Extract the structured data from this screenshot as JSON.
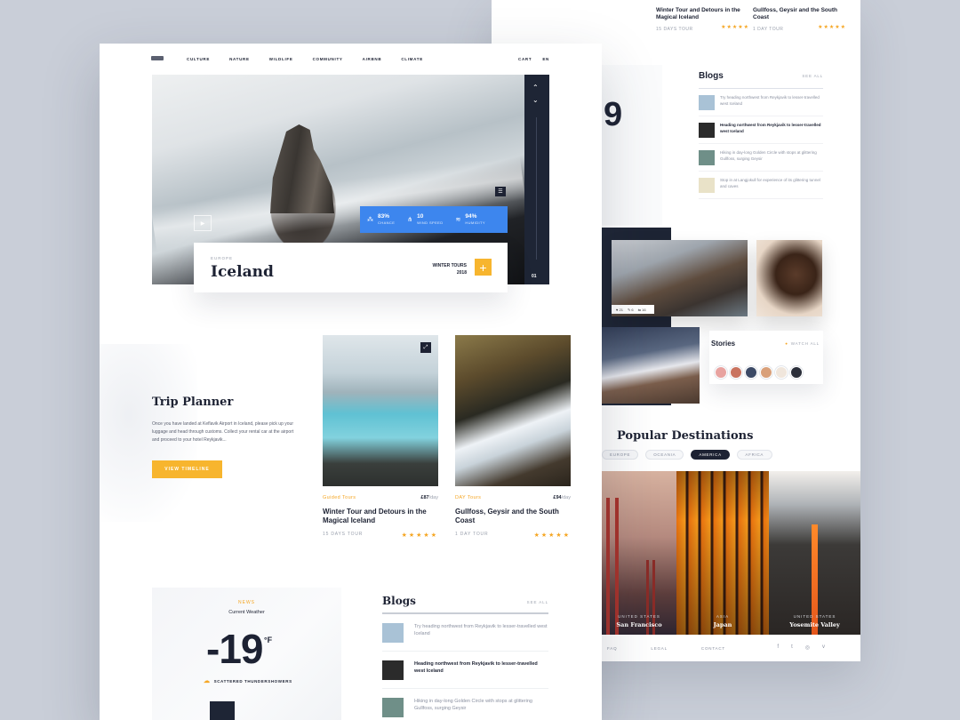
{
  "back": {
    "top_cards": [
      {
        "title": "Winter Tour and Detours in the Magical Iceland",
        "meta": "15 DAYS TOUR",
        "stars": "★★★★★"
      },
      {
        "title": "Gullfoss, Geysir and the South Coast",
        "meta": "1 DAY TOUR",
        "stars": "★★★★★"
      }
    ],
    "blogs": {
      "title": "Blogs",
      "see_all": "SEE ALL",
      "items": [
        {
          "text": "Try heading northwest from Reykjavik to lesser-travelled west Iceland",
          "highlight": false,
          "color": "#a9c2d6"
        },
        {
          "text": "Heading northwest from Reykjavik to lesser-travelled west Iceland",
          "highlight": true,
          "color": "#2b2b2b"
        },
        {
          "text": "Hiking in day-long Golden Circle with stops at glittering Gullfoss, surging Geysir",
          "highlight": false,
          "color": "#6f8f88"
        },
        {
          "text": "Stop in at Langjokull for experience of its glittering tunnel and caves",
          "highlight": false,
          "color": "#e9e2c8"
        }
      ]
    },
    "temp_partial": "9",
    "photo_bar": {
      "likes": "♥ 21",
      "comments": "✎ 6",
      "shares": "⇆ 16"
    },
    "stories": {
      "title": "Stories",
      "watch_all": "WATCH ALL",
      "avatar_colors": [
        "#e8a3a0",
        "#c9735f",
        "#3c4a66",
        "#d9a07a",
        "#f0e6dc",
        "#2b2f3a"
      ]
    },
    "popular": {
      "title": "Popular Destinations",
      "regions": [
        {
          "label": "EUROPE",
          "active": false
        },
        {
          "label": "OCEANIA",
          "active": false
        },
        {
          "label": "AMERICA",
          "active": true
        },
        {
          "label": "AFRICA",
          "active": false
        }
      ],
      "destinations": [
        {
          "country": "UNITED STATES",
          "name": "San Francisco"
        },
        {
          "country": "ASIA",
          "name": "Japan"
        },
        {
          "country": "UNITED STATES",
          "name": "Yosemite Valley"
        }
      ]
    },
    "footer": {
      "links": [
        "FAQ",
        "LEGAL",
        "CONTACT"
      ],
      "social": [
        "f",
        "t",
        "◎",
        "v"
      ]
    }
  },
  "front": {
    "nav": [
      "CULTURE",
      "NATURE",
      "WILDLIFE",
      "COMMUNITY",
      "AIRBNB",
      "CLIMATE"
    ],
    "nav_right": [
      "CART",
      "EN"
    ],
    "hero": {
      "rail_number": "01",
      "stats": [
        {
          "icon": "⁂",
          "value": "83%",
          "label": "CHANCE"
        },
        {
          "icon": "⋔",
          "value": "10",
          "label": "WIND SPEED"
        },
        {
          "icon": "≋",
          "value": "94%",
          "label": "HUMIDITY"
        }
      ],
      "region": "EUROPE",
      "name": "Iceland",
      "tours_line1": "WINTER TOURS",
      "tours_line2": "2018"
    },
    "trip_planner": {
      "title": "Trip Planner",
      "description": "Once you have landed at Keflavik Airport in Iceland, please pick up your luggage and head through customs. Collect your rental car at the airport and proceed to your hotel Reykjavik...",
      "button": "VIEW TIMELINE"
    },
    "tours": [
      {
        "category": "Guided Tours",
        "price": "£87",
        "per": "/day",
        "title": "Winter Tour and Detours in the Magical Iceland",
        "days": "15 DAYS TOUR",
        "stars": "★★★★★"
      },
      {
        "category": "DAY Tours",
        "price": "£94",
        "per": "/day",
        "title": "Gullfoss, Geysir and the South Coast",
        "days": "1 DAY TOUR",
        "stars": "★★★★★"
      }
    ],
    "weather": {
      "news": "NEWS",
      "label": "Current Weather",
      "temp": "-19",
      "unit": "°F",
      "condition": "SCATTERED THUNDERSHOWERS"
    },
    "blogs": {
      "title": "Blogs",
      "see_all": "SEE ALL",
      "items": [
        {
          "text": "Try heading northwest from Reykjavik to lesser-travelled west Iceland",
          "highlight": false,
          "color": "#a9c2d6"
        },
        {
          "text": "Heading northwest from Reykjavik to lesser-travelled west Iceland",
          "highlight": true,
          "color": "#2b2b2b"
        },
        {
          "text": "Hiking in day-long Golden Circle with stops at glittering Gullfoss, surging Geysir",
          "highlight": false,
          "color": "#6f8f88"
        }
      ]
    }
  }
}
